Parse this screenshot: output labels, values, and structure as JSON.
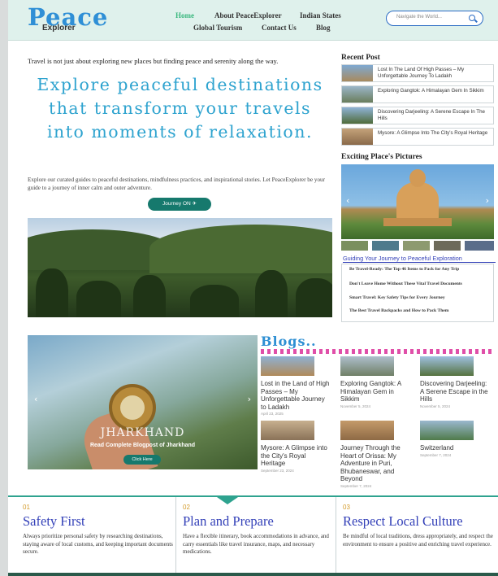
{
  "header": {
    "logo_main": "Peace",
    "logo_sub": "Explorer",
    "nav": [
      {
        "label": "Home",
        "active": true
      },
      {
        "label": "About PeaceExplorer"
      },
      {
        "label": "Indian States"
      },
      {
        "label": "Global Tourism"
      },
      {
        "label": "Contact Us"
      },
      {
        "label": "Blog"
      }
    ],
    "search_placeholder": "Navigate the World..."
  },
  "hero": {
    "tagline": "Travel is not just about exploring new places but finding peace and serenity along the way.",
    "headline": "Explore peaceful destinations that transform your travels into moments of relaxation.",
    "intro": "Explore our curated guides to peaceful destinations, mindfulness practices, and inspirational stories. Let PeaceExplorer be your guide to a journey of inner calm and outer adventure.",
    "button": "Journey ON"
  },
  "sidebar": {
    "recent_title": "Recent Post",
    "recent_posts": [
      "Lost In The Land Of High Passes – My Unforgettable Journey To Ladakh",
      "Exploring Gangtok: A Himalayan Gem In Sikkim",
      "Discovering Darjeeling: A Serene Escape In The Hills",
      "Mysore: A Glimpse Into The City's Royal Heritage"
    ],
    "pictures_title": "Exciting Place's Pictures",
    "guide_title": "Guiding Your Journey to Peaceful Exploration",
    "guide_items": [
      "Be Travel-Ready: The Top 46 Items to Pack for Any Trip",
      "Don't Leave Home Without These Vital Travel Documents",
      "Smart Travel: Key Safety Tips for Every Journey",
      "The Best Travel Backpacks and How to Pack Them"
    ]
  },
  "feature": {
    "title": "JHARKHAND",
    "subtitle": "Read Complete Blogpost of Jharkhand",
    "button": "Click Here"
  },
  "blogs": {
    "title": "Blogs..",
    "cards": [
      {
        "title": "Lost in the Land of High Passes – My Unforgettable Journey to Ladakh",
        "date": "April 23, 2025"
      },
      {
        "title": "Exploring Gangtok: A Himalayan Gem in Sikkim",
        "date": "November 5, 2024"
      },
      {
        "title": "Discovering Darjeeling: A Serene Escape in the Hills",
        "date": "November 5, 2024"
      },
      {
        "title": "Mysore: A Glimpse into the City's Royal Heritage",
        "date": "September 23, 2024"
      },
      {
        "title": "Journey Through the Heart of Orissa: My Adventure in Puri, Bhubaneswar, and Beyond",
        "date": "September 7, 2024"
      },
      {
        "title": "Switzerland",
        "date": "September 7, 2024"
      }
    ]
  },
  "tips": [
    {
      "num": "01",
      "title": "Safety First",
      "text": "Always prioritize personal safety by researching destinations, staying aware of local customs, and keeping important documents secure."
    },
    {
      "num": "02",
      "title": "Plan and Prepare",
      "text": "Have a flexible itinerary, book accommodations in advance, and carry essentials like travel insurance, maps, and necessary medications."
    },
    {
      "num": "03",
      "title": "Respect Local Culture",
      "text": "Be mindful of local traditions, dress appropriately, and respect the environment to ensure a positive and enriching travel experience."
    }
  ],
  "colors": {
    "accent": "#2ea3cf",
    "brand_green": "#16796d",
    "heading_blue": "#3340b8"
  }
}
